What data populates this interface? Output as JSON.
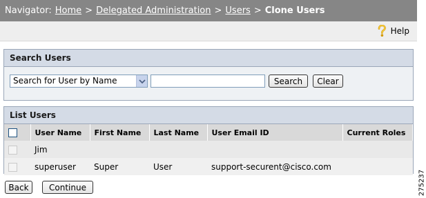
{
  "navigator": {
    "prefix": "Navigator:",
    "crumbs": [
      "Home",
      "Delegated Administration",
      "Users"
    ],
    "separator": ">",
    "current": "Clone Users"
  },
  "help": {
    "label": "Help",
    "icon": "help-question-icon"
  },
  "search_panel": {
    "title": "Search Users",
    "select_value": "Search for User by Name",
    "input_value": "",
    "search_label": "Search",
    "clear_label": "Clear"
  },
  "list_panel": {
    "title": "List Users",
    "columns": [
      "User Name",
      "First Name",
      "Last Name",
      "User Email ID",
      "Current Roles"
    ],
    "rows": [
      {
        "user_name": "Jim",
        "first_name": "",
        "last_name": "",
        "email": "",
        "roles": ""
      },
      {
        "user_name": "superuser",
        "first_name": "Super",
        "last_name": "User",
        "email": "support-securent@cisco.com",
        "roles": ""
      }
    ]
  },
  "actions": {
    "back_label": "Back",
    "continue_label": "Continue"
  },
  "figure_number": "275237",
  "colors": {
    "navbar_bg": "#868686",
    "panel_header_bg": "#d4dbe6",
    "panel_border": "#9aa6b8",
    "table_header_bg": "#d9d9d9"
  }
}
